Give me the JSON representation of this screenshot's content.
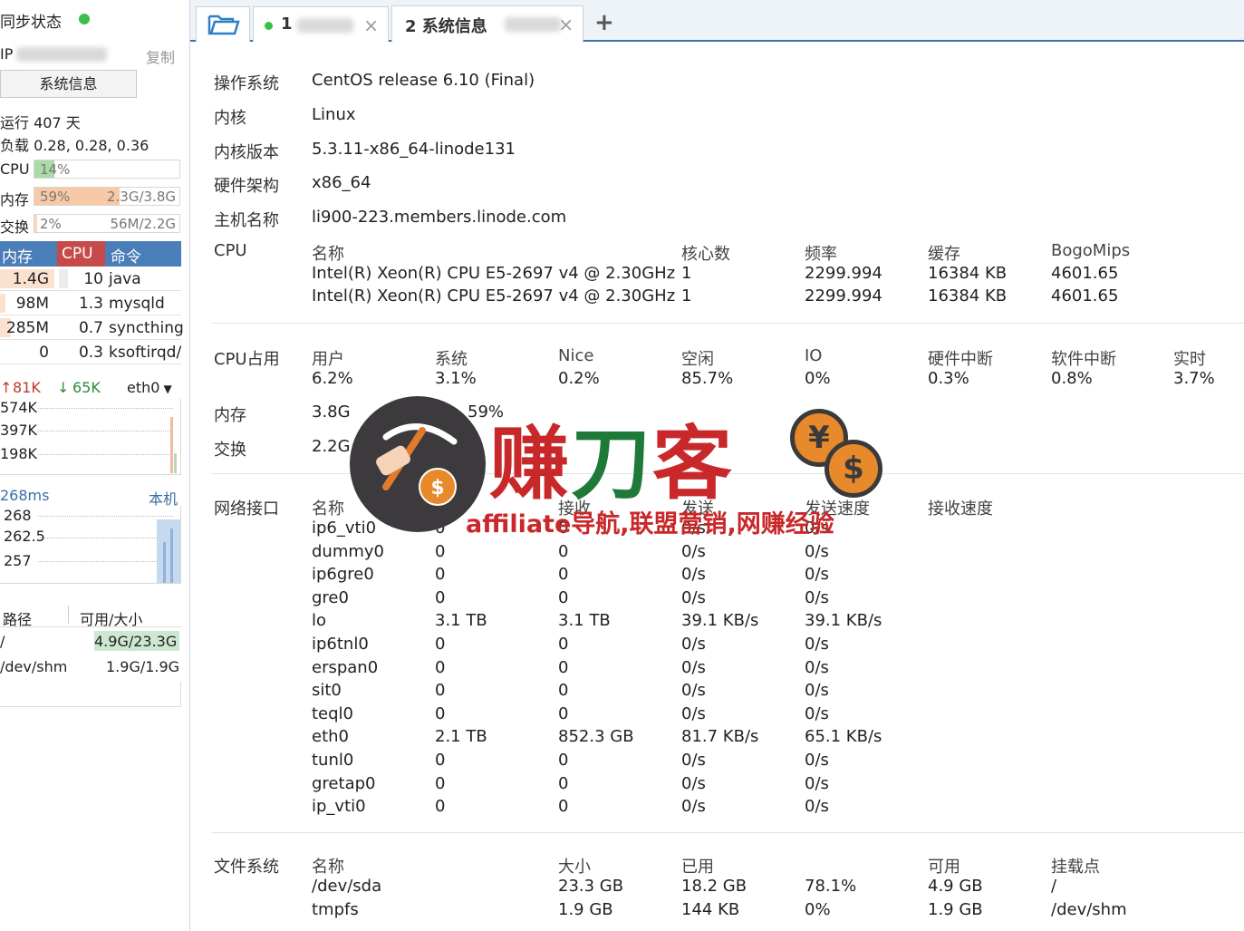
{
  "sidebar": {
    "sync_label": "同步状态",
    "ip_prefix": "IP",
    "copy_label": "复制",
    "sysinfo_button": "系统信息",
    "uptime": "运行 407 天",
    "load": "负载 0.28, 0.28, 0.36",
    "cpu": {
      "label": "CPU",
      "pct": "14%",
      "fraction": 0.14
    },
    "mem": {
      "label": "内存",
      "pct": "59%",
      "amount": "2.3G/3.8G",
      "fraction": 0.59
    },
    "swap": {
      "label": "交换",
      "pct": "2%",
      "amount": "56M/2.2G",
      "fraction": 0.02
    },
    "process_headers": {
      "mem": "内存",
      "cpu": "CPU",
      "cmd": "命令"
    },
    "processes": [
      {
        "mem": "1.4G",
        "cpu": "10",
        "cmd": "java"
      },
      {
        "mem": "98M",
        "cpu": "1.3",
        "cmd": "mysqld"
      },
      {
        "mem": "285M",
        "cpu": "0.7",
        "cmd": "syncthing"
      },
      {
        "mem": "0",
        "cpu": "0.3",
        "cmd": "ksoftirqd/"
      }
    ],
    "net": {
      "up": "81K",
      "down": "65K",
      "iface": "eth0",
      "ticks": [
        "574K",
        "397K",
        "198K"
      ]
    },
    "latency": {
      "value": "268ms",
      "host": "本机",
      "ticks": [
        "268",
        "262.5",
        "257"
      ]
    },
    "fs": {
      "headers": {
        "path": "路径",
        "size": "可用/大小"
      },
      "rows": [
        {
          "path": "/",
          "size": "4.9G/23.3G"
        },
        {
          "path": "/dev/shm",
          "size": "1.9G/1.9G"
        }
      ]
    }
  },
  "tabs": [
    {
      "label": "1"
    },
    {
      "label": "2 系统信息"
    }
  ],
  "main": {
    "os": {
      "label": "操作系统",
      "value": "CentOS release 6.10 (Final)"
    },
    "kernel": {
      "label": "内核",
      "value": "Linux"
    },
    "kernel_version": {
      "label": "内核版本",
      "value": "5.3.11-x86_64-linode131"
    },
    "arch": {
      "label": "硬件架构",
      "value": "x86_64"
    },
    "hostname": {
      "label": "主机名称",
      "value": "li900-223.members.linode.com"
    },
    "cpu": {
      "label": "CPU",
      "headers": [
        "名称",
        "核心数",
        "频率",
        "缓存",
        "BogoMips"
      ],
      "rows": [
        [
          "Intel(R) Xeon(R) CPU E5-2697 v4 @ 2.30GHz",
          "1",
          "2299.994",
          "16384 KB",
          "4601.65"
        ],
        [
          "Intel(R) Xeon(R) CPU E5-2697 v4 @ 2.30GHz",
          "1",
          "2299.994",
          "16384 KB",
          "4601.65"
        ]
      ]
    },
    "cpu_usage": {
      "label": "CPU占用",
      "headers": [
        "用户",
        "系统",
        "Nice",
        "空闲",
        "IO",
        "硬件中断",
        "软件中断",
        "实时"
      ],
      "values": [
        "6.2%",
        "3.1%",
        "0.2%",
        "85.7%",
        "0%",
        "0.3%",
        "0.8%",
        "3.7%"
      ]
    },
    "memory": {
      "label": "内存",
      "total": "3.8G",
      "pct": "59%"
    },
    "swap": {
      "label": "交换",
      "total": "2.2G"
    },
    "network": {
      "label": "网络接口",
      "headers": [
        "名称",
        "接收",
        "发送",
        "发送速度",
        "接收速度"
      ],
      "rows": [
        [
          "ip6_vti0",
          "0",
          "0",
          "0/s",
          "0/s"
        ],
        [
          "dummy0",
          "0",
          "0",
          "0/s",
          "0/s"
        ],
        [
          "ip6gre0",
          "0",
          "0",
          "0/s",
          "0/s"
        ],
        [
          "gre0",
          "0",
          "0",
          "0/s",
          "0/s"
        ],
        [
          "lo",
          "3.1 TB",
          "3.1 TB",
          "39.1 KB/s",
          "39.1 KB/s"
        ],
        [
          "ip6tnl0",
          "0",
          "0",
          "0/s",
          "0/s"
        ],
        [
          "erspan0",
          "0",
          "0",
          "0/s",
          "0/s"
        ],
        [
          "sit0",
          "0",
          "0",
          "0/s",
          "0/s"
        ],
        [
          "teql0",
          "0",
          "0",
          "0/s",
          "0/s"
        ],
        [
          "eth0",
          "2.1 TB",
          "852.3 GB",
          "81.7 KB/s",
          "65.1 KB/s"
        ],
        [
          "tunl0",
          "0",
          "0",
          "0/s",
          "0/s"
        ],
        [
          "gretap0",
          "0",
          "0",
          "0/s",
          "0/s"
        ],
        [
          "ip_vti0",
          "0",
          "0",
          "0/s",
          "0/s"
        ]
      ]
    },
    "filesystem": {
      "label": "文件系统",
      "headers": [
        "名称",
        "大小",
        "已用",
        "",
        "可用",
        "挂载点"
      ],
      "rows": [
        [
          "/dev/sda",
          "23.3 GB",
          "18.2 GB",
          "78.1%",
          "4.9 GB",
          "/"
        ],
        [
          "tmpfs",
          "1.9 GB",
          "144 KB",
          "0%",
          "1.9 GB",
          "/dev/shm"
        ]
      ]
    }
  },
  "watermark": {
    "title_a": "赚",
    "title_b": "刀",
    "title_c": "客",
    "subtitle": "affiliate导航,联盟营销,网赚经验",
    "coin1": "¥",
    "coin2": "$",
    "coin3": "$"
  }
}
